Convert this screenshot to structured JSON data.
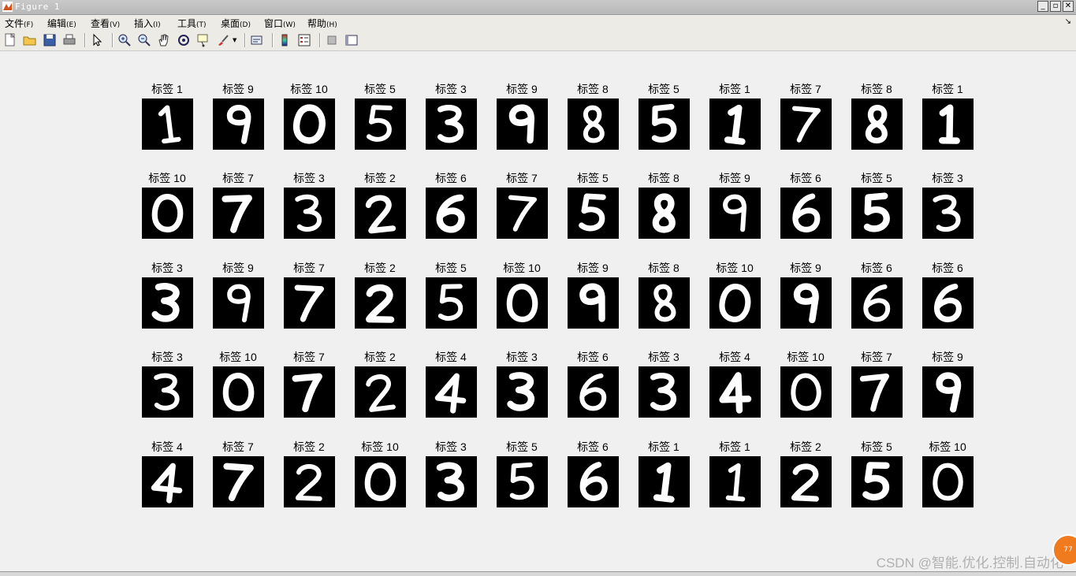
{
  "window": {
    "title": "Figure 1",
    "icon": "matlab-icon"
  },
  "menu": [
    {
      "label": "文件",
      "accel": "(F)"
    },
    {
      "label": "编辑",
      "accel": "(E)"
    },
    {
      "label": "查看",
      "accel": "(V)"
    },
    {
      "label": "插入",
      "accel": "(I)"
    },
    {
      "label": "工具",
      "accel": "(T)"
    },
    {
      "label": "桌面",
      "accel": "(D)"
    },
    {
      "label": "窗口",
      "accel": "(W)"
    },
    {
      "label": "帮助",
      "accel": "(H)"
    }
  ],
  "toolbar": [
    "new-figure-icon",
    "open-file-icon",
    "save-icon",
    "print-icon",
    "|",
    "edit-plot-arrow-icon",
    "|",
    "zoom-in-icon",
    "zoom-out-icon",
    "pan-hand-icon",
    "rotate-3d-icon",
    "data-cursor-icon",
    "brush-icon",
    "|",
    "link-plot-icon",
    "|",
    "colorbar-icon",
    "legend-icon",
    "|",
    "hide-plot-tools-icon",
    "show-plot-tools-icon"
  ],
  "grid": {
    "rows": 5,
    "cols": 12,
    "label_prefix": "标签",
    "cells": [
      [
        {
          "label": "标签 1",
          "digit": "1"
        },
        {
          "label": "标签 9",
          "digit": "9"
        },
        {
          "label": "标签 10",
          "digit": "0"
        },
        {
          "label": "标签 5",
          "digit": "5"
        },
        {
          "label": "标签 3",
          "digit": "3"
        },
        {
          "label": "标签 9",
          "digit": "9"
        },
        {
          "label": "标签 8",
          "digit": "8"
        },
        {
          "label": "标签 5",
          "digit": "5"
        },
        {
          "label": "标签 1",
          "digit": "1"
        },
        {
          "label": "标签 7",
          "digit": "7"
        },
        {
          "label": "标签 8",
          "digit": "8"
        },
        {
          "label": "标签 1",
          "digit": "1"
        }
      ],
      [
        {
          "label": "标签 10",
          "digit": "0"
        },
        {
          "label": "标签 7",
          "digit": "7"
        },
        {
          "label": "标签 3",
          "digit": "3"
        },
        {
          "label": "标签 2",
          "digit": "2"
        },
        {
          "label": "标签 6",
          "digit": "6"
        },
        {
          "label": "标签 7",
          "digit": "7"
        },
        {
          "label": "标签 5",
          "digit": "5"
        },
        {
          "label": "标签 8",
          "digit": "8"
        },
        {
          "label": "标签 9",
          "digit": "9"
        },
        {
          "label": "标签 6",
          "digit": "6"
        },
        {
          "label": "标签 5",
          "digit": "5"
        },
        {
          "label": "标签 3",
          "digit": "3"
        }
      ],
      [
        {
          "label": "标签 3",
          "digit": "3"
        },
        {
          "label": "标签 9",
          "digit": "9"
        },
        {
          "label": "标签 7",
          "digit": "7"
        },
        {
          "label": "标签 2",
          "digit": "2"
        },
        {
          "label": "标签 5",
          "digit": "5"
        },
        {
          "label": "标签 10",
          "digit": "0"
        },
        {
          "label": "标签 9",
          "digit": "9"
        },
        {
          "label": "标签 8",
          "digit": "8"
        },
        {
          "label": "标签 10",
          "digit": "0"
        },
        {
          "label": "标签 9",
          "digit": "9"
        },
        {
          "label": "标签 6",
          "digit": "6"
        },
        {
          "label": "标签 6",
          "digit": "6"
        }
      ],
      [
        {
          "label": "标签 3",
          "digit": "3"
        },
        {
          "label": "标签 10",
          "digit": "0"
        },
        {
          "label": "标签 7",
          "digit": "7"
        },
        {
          "label": "标签 2",
          "digit": "2"
        },
        {
          "label": "标签 4",
          "digit": "4"
        },
        {
          "label": "标签 3",
          "digit": "3"
        },
        {
          "label": "标签 6",
          "digit": "6"
        },
        {
          "label": "标签 3",
          "digit": "3"
        },
        {
          "label": "标签 4",
          "digit": "4"
        },
        {
          "label": "标签 10",
          "digit": "0"
        },
        {
          "label": "标签 7",
          "digit": "7"
        },
        {
          "label": "标签 9",
          "digit": "9"
        }
      ],
      [
        {
          "label": "标签 4",
          "digit": "4"
        },
        {
          "label": "标签 7",
          "digit": "7"
        },
        {
          "label": "标签 2",
          "digit": "2"
        },
        {
          "label": "标签 10",
          "digit": "0"
        },
        {
          "label": "标签 3",
          "digit": "3"
        },
        {
          "label": "标签 5",
          "digit": "5"
        },
        {
          "label": "标签 6",
          "digit": "6"
        },
        {
          "label": "标签 1",
          "digit": "1"
        },
        {
          "label": "标签 1",
          "digit": "1"
        },
        {
          "label": "标签 2",
          "digit": "2"
        },
        {
          "label": "标签 5",
          "digit": "5"
        },
        {
          "label": "标签 10",
          "digit": "0"
        }
      ]
    ]
  },
  "watermark": "CSDN @智能.优化.控制.自动化",
  "colors": {
    "background": "#f0f0f0",
    "image_bg": "#000000",
    "digit": "#ffffff"
  }
}
